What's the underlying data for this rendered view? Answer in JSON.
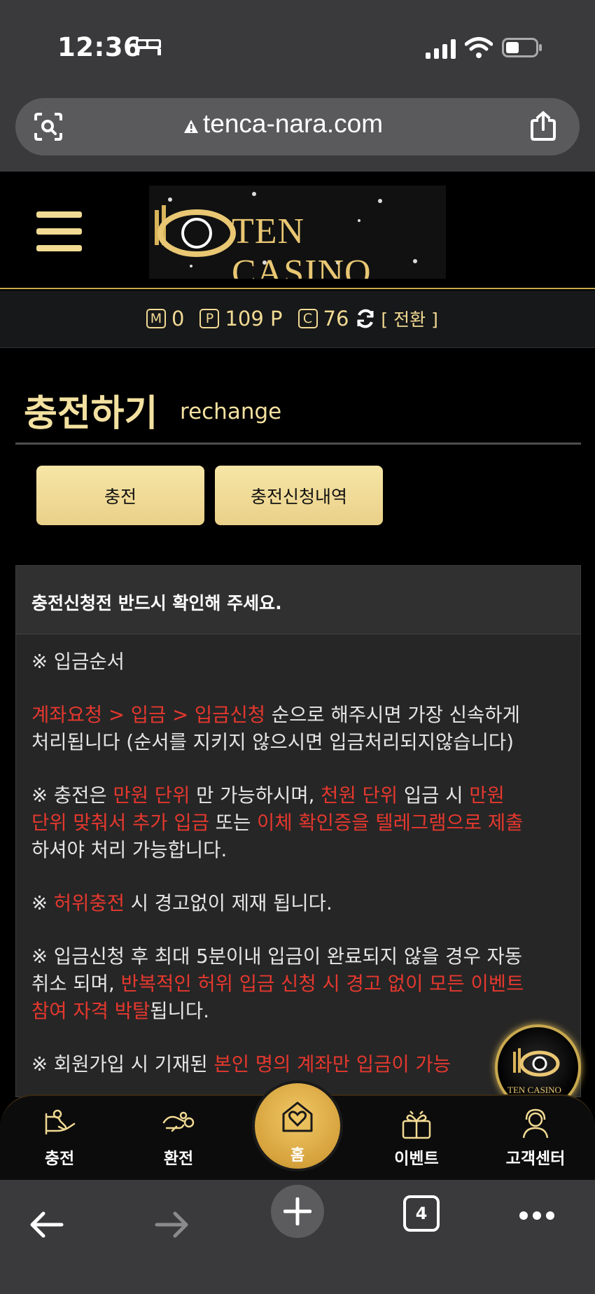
{
  "status_bar": {
    "time": "12:36"
  },
  "browser": {
    "url": "tenca-nara.com",
    "tab_count": "4"
  },
  "site": {
    "logo_text": "TEN CASINO"
  },
  "balance": {
    "money_badge": "M",
    "money_value": "0",
    "point_badge": "P",
    "point_value": "109 P",
    "coin_badge": "C",
    "coin_value": "76",
    "switch_label": "[ 전환 ]"
  },
  "page": {
    "title": "충전하기",
    "subtitle": "rechange"
  },
  "tabs": {
    "charge": "충전",
    "history": "충전신청내역"
  },
  "notice": {
    "header": "충전신청전 반드시 확인해 주세요.",
    "p1": "※ 입금순서",
    "p2a_red": "계좌요청 > 입금 > 입금신청",
    "p2b": " 순으로 해주시면 가장 신속하게",
    "p2c": "처리됩니다 (순서를 지키지 않으시면 입금처리되지않습니다)",
    "p3a": "※ 충전은 ",
    "p3b_red": "만원 단위",
    "p3c": " 만 가능하시며, ",
    "p3d_red": "천원 단위",
    "p3e": " 입금 시 ",
    "p3f_red": "만원",
    "p3g_red": "단위 맞춰서 추가 입금",
    "p3h": " 또는 ",
    "p3i_red": "이체 확인증을 텔레그램으로 제출",
    "p3j": "하셔야 처리 가능합니다.",
    "p4a": "※ ",
    "p4b_red": "허위충전",
    "p4c": " 시 경고없이 제재 됩니다.",
    "p5a": "※ 입금신청 후 최대 5분이내 입금이 완료되지 않을 경우 자동",
    "p5b": "취소 되며, ",
    "p5c_red": "반복적인 허위 입금 신청 시 경고 없이 모든 이벤트",
    "p5d_red": "참여 자격 박탈",
    "p5e": "됩니다.",
    "p6a": "※ 회원가입 시 기재된 ",
    "p6b_red": "본인 명의 계좌만 입금이 가능"
  },
  "floating_logo": {
    "text": "TEN CASINO"
  },
  "bottom_nav": {
    "charge": "충전",
    "exchange": "환전",
    "home": "홈",
    "event": "이벤트",
    "support": "고객센터"
  },
  "colors": {
    "gold": "#f1da93",
    "red": "#e5382e",
    "button": "#f0dc97"
  }
}
